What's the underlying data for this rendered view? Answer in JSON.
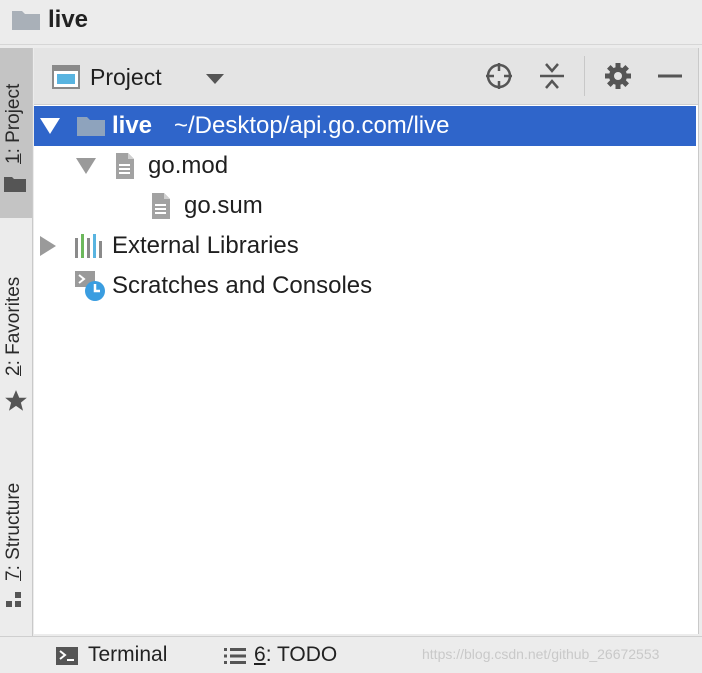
{
  "window": {
    "title": "live"
  },
  "left_stripe": {
    "tabs": [
      {
        "mnemonic": "1",
        "label": ": Project",
        "icon": "folder-icon",
        "active": true
      },
      {
        "mnemonic": "2",
        "label": ": Favorites",
        "icon": "star-icon",
        "active": false
      },
      {
        "mnemonic": "7",
        "label": ": Structure",
        "icon": "structure-icon",
        "active": false
      }
    ]
  },
  "panel": {
    "view_selector": {
      "label": "Project",
      "icon": "project-view-icon"
    },
    "actions": [
      {
        "name": "locate",
        "icon": "crosshair-icon"
      },
      {
        "name": "collapse-all",
        "icon": "collapse-all-icon"
      },
      {
        "name": "settings",
        "icon": "gear-icon"
      },
      {
        "name": "hide",
        "icon": "minimize-icon"
      }
    ]
  },
  "tree": {
    "items": [
      {
        "name": "live",
        "path": "~/Desktop/api.go.com/live",
        "type": "folder",
        "expanded": true,
        "selected": true
      },
      {
        "name": "go.mod",
        "type": "file",
        "expanded": true
      },
      {
        "name": "go.sum",
        "type": "file"
      },
      {
        "name": "External Libraries",
        "type": "library",
        "expanded": false
      },
      {
        "name": "Scratches and Consoles",
        "type": "scratches"
      }
    ]
  },
  "bottom_bar": {
    "tabs": [
      {
        "label": "Terminal",
        "icon": "terminal-icon"
      },
      {
        "mnemonic": "6",
        "label": ": TODO",
        "icon": "todo-list-icon"
      }
    ],
    "watermark": "https://blog.csdn.net/github_26672553"
  },
  "colors": {
    "selection": "#2f65ca",
    "folder": "#8a98a8",
    "project_icon_accent": "#59b4e0"
  }
}
